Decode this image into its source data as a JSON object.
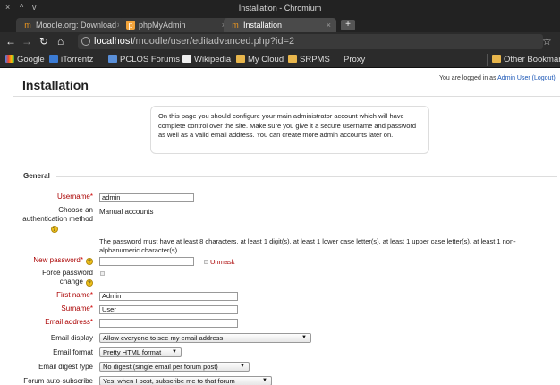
{
  "window": {
    "title": "Installation - Chromium",
    "controls": [
      "×",
      "^",
      "v"
    ]
  },
  "tabs": [
    {
      "label": "Moodle.org: Download",
      "icon": "moodle-icon"
    },
    {
      "label": "phpMyAdmin",
      "icon": "phpmyadmin-icon"
    },
    {
      "label": "Installation",
      "icon": "moodle-icon"
    }
  ],
  "toolbar": {
    "url_host": "localhost",
    "url_path": "/moodle/user/editadvanced.php?id=2"
  },
  "bookmarks": [
    {
      "label": "Google"
    },
    {
      "label": "iTorrentz"
    },
    {
      "label": "PCLOS Forums"
    },
    {
      "label": "Wikipedia"
    },
    {
      "label": "My Cloud"
    },
    {
      "label": "SRPMS"
    },
    {
      "label": "Proxy"
    },
    {
      "label": "Other Bookmarks"
    }
  ],
  "page": {
    "title": "Installation",
    "logged_in_prefix": "You are logged in as ",
    "logged_in_user": "Admin User",
    "logout_label": "(Logout)",
    "notice": "On this page you should configure your main administrator account which will have complete control over the site. Make sure you give it a secure username and password as well as a valid email address. You can create more admin accounts later on.",
    "section_general": "General"
  },
  "form": {
    "username_label": "Username",
    "username_value": "admin",
    "auth_label_line1": "Choose an",
    "auth_label_line2": "authentication method",
    "auth_value": "Manual accounts",
    "password_rules": "The password must have at least 8 characters, at least 1 digit(s), at least 1 lower case letter(s), at least 1 upper case letter(s), at least 1 non-alphanumeric character(s)",
    "new_password_label": "New password",
    "new_password_value": "",
    "unmask_label": "Unmask",
    "force_change_line1": "Force password",
    "force_change_line2": "change",
    "firstname_label": "First name",
    "firstname_value": "Admin",
    "surname_label": "Surname",
    "surname_value": "User",
    "email_label": "Email address",
    "email_value": "",
    "email_display_label": "Email display",
    "email_display_value": "Allow everyone to see my email address",
    "email_format_label": "Email format",
    "email_format_value": "Pretty HTML format",
    "email_digest_label": "Email digest type",
    "email_digest_value": "No digest (single email per forum post)",
    "forum_auto_label": "Forum auto-subscribe",
    "forum_auto_value": "Yes: when I post, subscribe me to that forum"
  },
  "colors": {
    "required": "#aa0000",
    "link": "#1a56b6",
    "help_icon": "#f2c21a"
  }
}
